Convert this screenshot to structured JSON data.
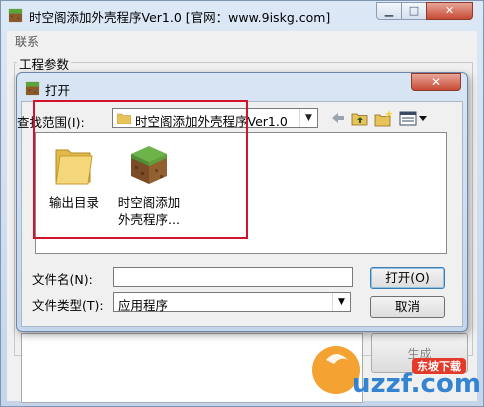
{
  "main_window": {
    "title": "时空阁添加外壳程序Ver1.0 [官网：www.9iskg.com]",
    "menu_item": "联系",
    "group_label": "工程参数",
    "generate_label": "生成"
  },
  "dialog": {
    "title": "打开",
    "look_in_label": "查找范围(I):",
    "look_in_value": "时空阁添加外壳程序Ver1.0",
    "files": [
      {
        "name": "输出目录",
        "icon": "folder-icon"
      },
      {
        "name": "时空阁添加外壳程序...",
        "icon": "minecraft-block-icon"
      }
    ],
    "file_name_label": "文件名(N):",
    "file_name_value": "",
    "file_type_label": "文件类型(T):",
    "file_type_value": "应用程序",
    "open_button": "打开(O)",
    "cancel_button": "取消"
  },
  "watermark": {
    "brand": "uzzf.com",
    "badge": "东坡下载"
  },
  "colors": {
    "highlight": "#d2122e",
    "close": "#c64b35"
  }
}
